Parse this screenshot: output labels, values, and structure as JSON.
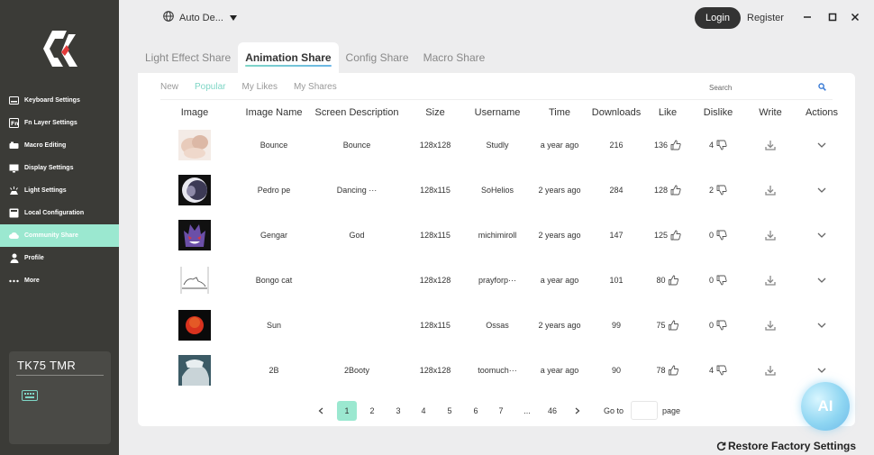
{
  "app": {
    "language": "Auto De...",
    "login_label": "Login",
    "register_label": "Register"
  },
  "sidebar": {
    "items": [
      {
        "label": "Keyboard Settings",
        "icon": "keyboard-icon"
      },
      {
        "label": "Fn Layer Settings",
        "icon": "fn-layer-icon"
      },
      {
        "label": "Macro Editing",
        "icon": "macro-icon"
      },
      {
        "label": "Display Settings",
        "icon": "display-icon"
      },
      {
        "label": "Light Settings",
        "icon": "light-icon"
      },
      {
        "label": "Local Configuration",
        "icon": "local-config-icon"
      },
      {
        "label": "Community Share",
        "icon": "community-icon",
        "active": true
      },
      {
        "label": "Profile",
        "icon": "profile-icon"
      },
      {
        "label": "More",
        "icon": "more-icon"
      }
    ],
    "device_name": "TK75 TMR"
  },
  "tabs": [
    {
      "label": "Light Effect Share"
    },
    {
      "label": "Animation Share",
      "active": true
    },
    {
      "label": "Config Share"
    },
    {
      "label": "Macro Share"
    }
  ],
  "subtabs": [
    {
      "label": "New"
    },
    {
      "label": "Popular",
      "active": true
    },
    {
      "label": "My Likes"
    },
    {
      "label": "My Shares"
    }
  ],
  "search": {
    "placeholder": "Search"
  },
  "table": {
    "headers": [
      "Image",
      "Image Name",
      "Screen Description",
      "Size",
      "Username",
      "Time",
      "Downloads",
      "Like",
      "Dislike",
      "Write",
      "Actions"
    ],
    "rows": [
      {
        "thumb": "bounce",
        "name": "Bounce",
        "desc": "Bounce",
        "size": "128x128",
        "user": "Studly",
        "time": "a year ago",
        "downloads": "216",
        "likes": "136",
        "dislikes": "4"
      },
      {
        "thumb": "pedro",
        "name": "Pedro pe",
        "desc": "Dancing ···",
        "size": "128x115",
        "user": "SoHelios",
        "time": "2 years ago",
        "downloads": "284",
        "likes": "128",
        "dislikes": "2"
      },
      {
        "thumb": "gengar",
        "name": "Gengar",
        "desc": "God",
        "size": "128x115",
        "user": "michimiroll",
        "time": "2 years ago",
        "downloads": "147",
        "likes": "125",
        "dislikes": "0"
      },
      {
        "thumb": "bongo",
        "name": "Bongo cat",
        "desc": "",
        "size": "128x128",
        "user": "prayforp···",
        "time": "a year ago",
        "downloads": "101",
        "likes": "80",
        "dislikes": "0"
      },
      {
        "thumb": "sun",
        "name": "Sun",
        "desc": "",
        "size": "128x115",
        "user": "Ossas",
        "time": "2 years ago",
        "downloads": "99",
        "likes": "75",
        "dislikes": "0"
      },
      {
        "thumb": "2b",
        "name": "2B",
        "desc": "2Booty",
        "size": "128x128",
        "user": "toomuch···",
        "time": "a year ago",
        "downloads": "90",
        "likes": "78",
        "dislikes": "4"
      }
    ]
  },
  "pagination": {
    "pages": [
      "1",
      "2",
      "3",
      "4",
      "5",
      "6",
      "7",
      "...",
      "46"
    ],
    "current": "1",
    "goto_label": "Go to",
    "page_label": "page"
  },
  "footer": {
    "restore_label": "Restore Factory Settings",
    "ai_label": "AI"
  }
}
